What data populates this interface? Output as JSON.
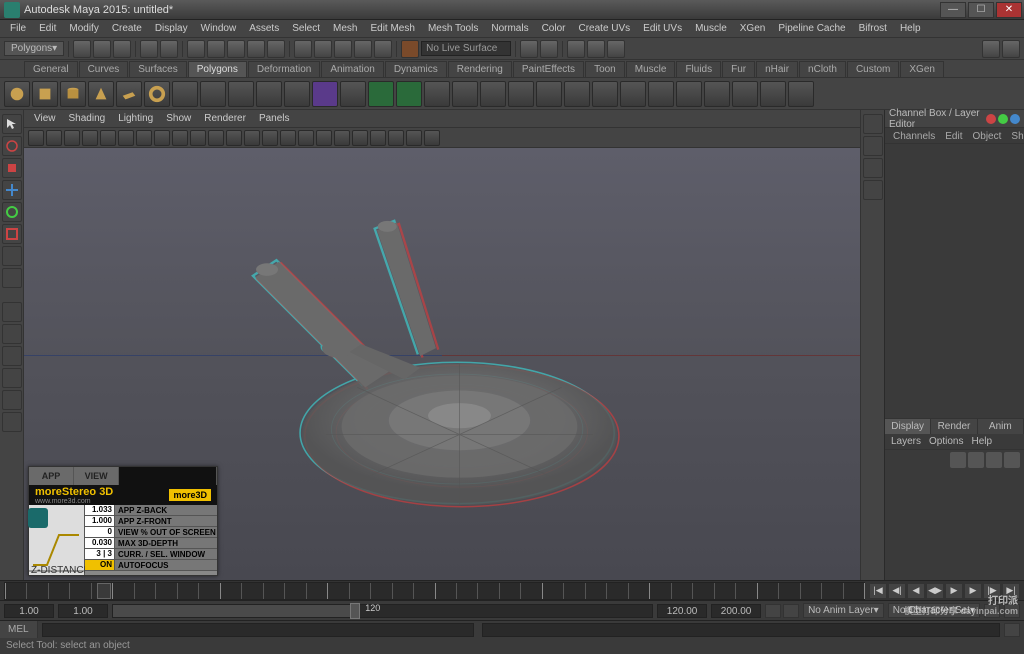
{
  "window": {
    "title": "Autodesk Maya 2015: untitled*"
  },
  "menu": [
    "File",
    "Edit",
    "Modify",
    "Create",
    "Display",
    "Window",
    "Assets",
    "Select",
    "Mesh",
    "Edit Mesh",
    "Mesh Tools",
    "Normals",
    "Color",
    "Create UVs",
    "Edit UVs",
    "Muscle",
    "XGen",
    "Pipeline Cache",
    "Bifrost",
    "Help"
  ],
  "toolbar": {
    "mode": "Polygons",
    "surface": "No Live Surface"
  },
  "shelf_tabs": [
    "General",
    "Curves",
    "Surfaces",
    "Polygons",
    "Deformation",
    "Animation",
    "Dynamics",
    "Rendering",
    "PaintEffects",
    "Toon",
    "Muscle",
    "Fluids",
    "Fur",
    "nHair",
    "nCloth",
    "Custom",
    "XGen"
  ],
  "active_shelf": "Polygons",
  "viewport_menu": [
    "View",
    "Shading",
    "Lighting",
    "Show",
    "Renderer",
    "Panels"
  ],
  "channel": {
    "title": "Channel Box / Layer Editor",
    "sub": [
      "Channels",
      "Edit",
      "Object",
      "Show"
    ],
    "tabs": [
      "Display",
      "Render",
      "Anim"
    ],
    "layerhdr": [
      "Layers",
      "Options",
      "Help"
    ]
  },
  "time": {
    "start": "1.00",
    "end": "200.00",
    "cur": "120",
    "rs": "1.00",
    "re": "120.00",
    "anim_layer": "No Anim Layer",
    "char_set": "No Character Set"
  },
  "cmd": {
    "label": "MEL"
  },
  "help": "Select Tool: select an object",
  "stereo": {
    "cols": [
      "APP",
      "VIEW"
    ],
    "brand": "moreStereo 3D",
    "url": "www.more3d.com",
    "tag": "more3D",
    "rows": [
      {
        "v": "1.033",
        "l": "APP Z-BACK"
      },
      {
        "v": "1.000",
        "l": "APP Z-FRONT"
      },
      {
        "v": "0",
        "l": "VIEW % OUT OF SCREEN"
      },
      {
        "v": "0.030",
        "l": "MAX 3D-DEPTH"
      },
      {
        "v": "3 | 3",
        "l": "CURR. / SEL. WINDOW No."
      },
      {
        "v": "ON",
        "l": "AUTOFOCUS",
        "on": true
      }
    ]
  },
  "watermark": {
    "big": "打印派",
    "sub": "模型打印分享 dayinpai.com"
  }
}
